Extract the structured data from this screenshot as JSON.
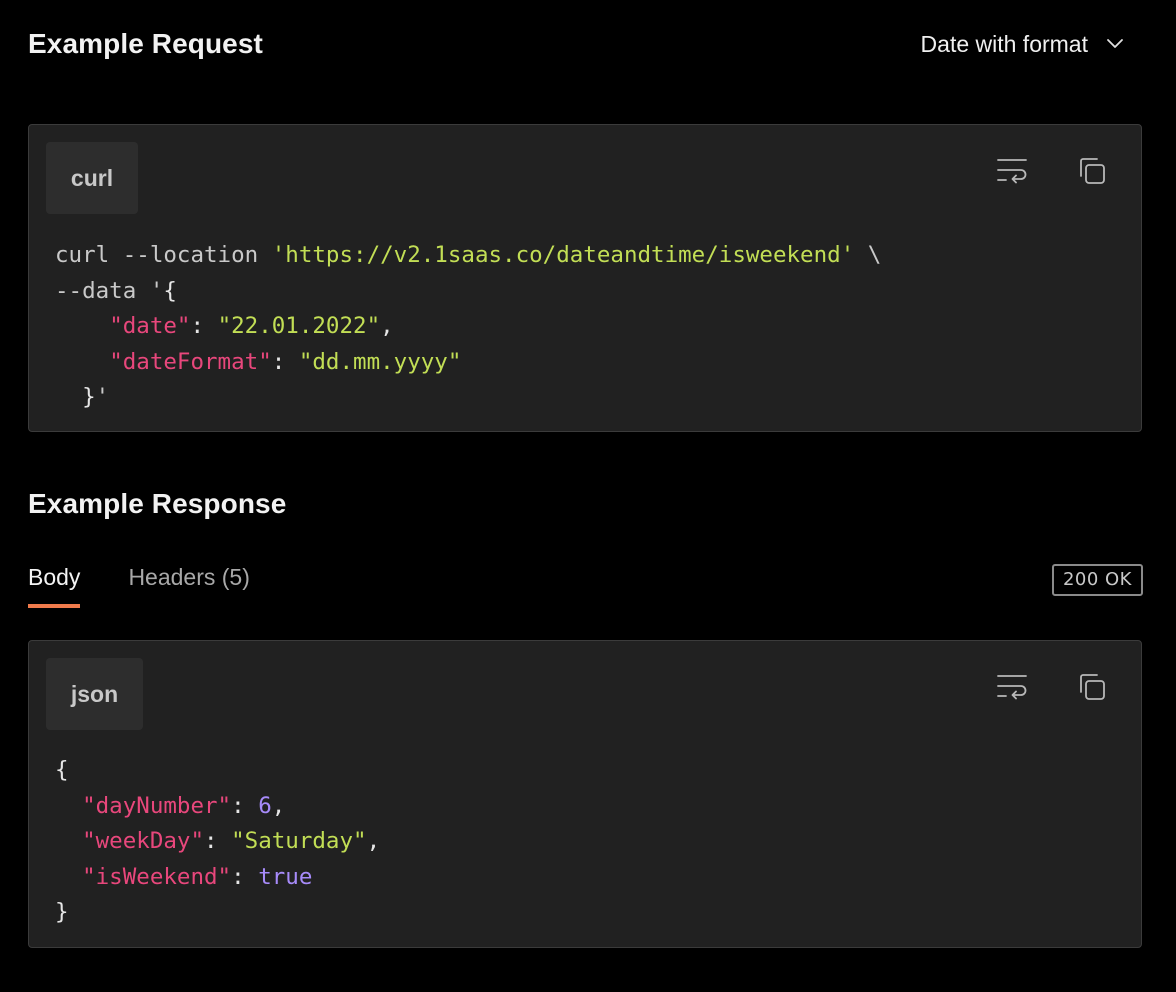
{
  "request": {
    "title": "Example Request",
    "example_selector": "Date with format",
    "language": "curl",
    "code": [
      [
        [
          "plain",
          "curl --location "
        ],
        [
          "str",
          "'https://v2.1saas.co/dateandtime/isweekend'"
        ],
        [
          "plain",
          " \\"
        ]
      ],
      [
        [
          "plain",
          "--data '"
        ],
        [
          "punc",
          "{"
        ]
      ],
      [
        [
          "plain",
          "    "
        ],
        [
          "key",
          "\"date\""
        ],
        [
          "punc",
          ": "
        ],
        [
          "str",
          "\"22.01.2022\""
        ],
        [
          "punc",
          ","
        ]
      ],
      [
        [
          "plain",
          "    "
        ],
        [
          "key",
          "\"dateFormat\""
        ],
        [
          "punc",
          ": "
        ],
        [
          "str",
          "\"dd.mm.yyyy\""
        ]
      ],
      [
        [
          "plain",
          "  "
        ],
        [
          "punc",
          "}"
        ],
        [
          "plain",
          "'"
        ]
      ]
    ]
  },
  "response": {
    "title": "Example Response",
    "tabs": [
      {
        "label": "Body",
        "active": true
      },
      {
        "label": "Headers (5)",
        "active": false
      }
    ],
    "status": "200 OK",
    "language": "json",
    "code": [
      [
        [
          "punc",
          "{"
        ]
      ],
      [
        [
          "plain",
          "  "
        ],
        [
          "key",
          "\"dayNumber\""
        ],
        [
          "punc",
          ": "
        ],
        [
          "num",
          "6"
        ],
        [
          "punc",
          ","
        ]
      ],
      [
        [
          "plain",
          "  "
        ],
        [
          "key",
          "\"weekDay\""
        ],
        [
          "punc",
          ": "
        ],
        [
          "str",
          "\"Saturday\""
        ],
        [
          "punc",
          ","
        ]
      ],
      [
        [
          "plain",
          "  "
        ],
        [
          "key",
          "\"isWeekend\""
        ],
        [
          "punc",
          ": "
        ],
        [
          "bool",
          "true"
        ]
      ],
      [
        [
          "punc",
          "}"
        ]
      ]
    ]
  },
  "icons": {
    "wrap": "wrap-lines-icon",
    "copy": "copy-icon",
    "chevron": "chevron-down-icon"
  },
  "colors": {
    "background": "#000000",
    "panel": "#212121",
    "panel_border": "#3b3b3b",
    "chip": "#2d2d2d",
    "string": "#c2de55",
    "key": "#e8477c",
    "number": "#a78bfa",
    "tab_accent": "#ef7a4b"
  }
}
